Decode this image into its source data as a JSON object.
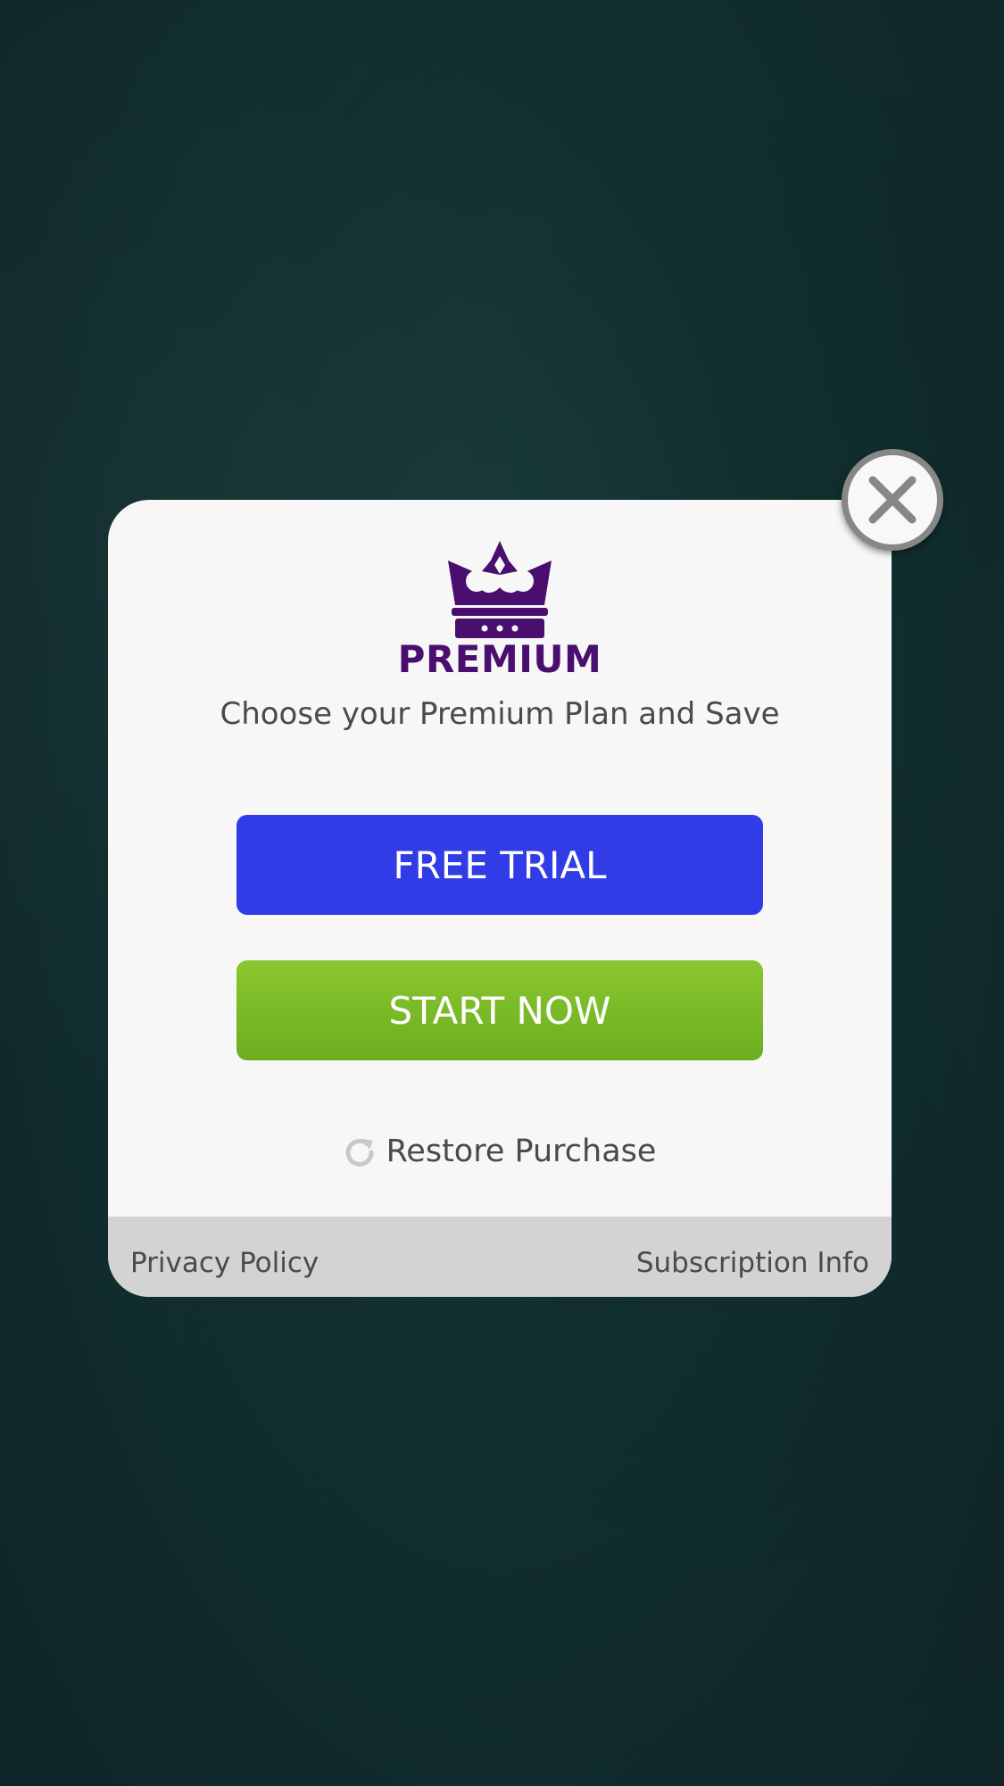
{
  "paywall": {
    "title": "PREMIUM",
    "subtitle": "Choose your Premium Plan and Save",
    "free_trial_label": "FREE TRIAL",
    "start_now_label": "START NOW",
    "restore_label": "Restore Purchase"
  },
  "footer": {
    "privacy_label": "Privacy Policy",
    "subscription_label": "Subscription Info"
  },
  "icons": {
    "crown": "crown-icon",
    "restore": "refresh-icon",
    "close": "close-icon"
  },
  "colors": {
    "brand_purple": "#4a0f6e",
    "free_trial": "#313ce6",
    "start_now": "#7ab826",
    "dialog_bg": "#f8f7f8",
    "footer_bg": "#d3d3d3"
  }
}
